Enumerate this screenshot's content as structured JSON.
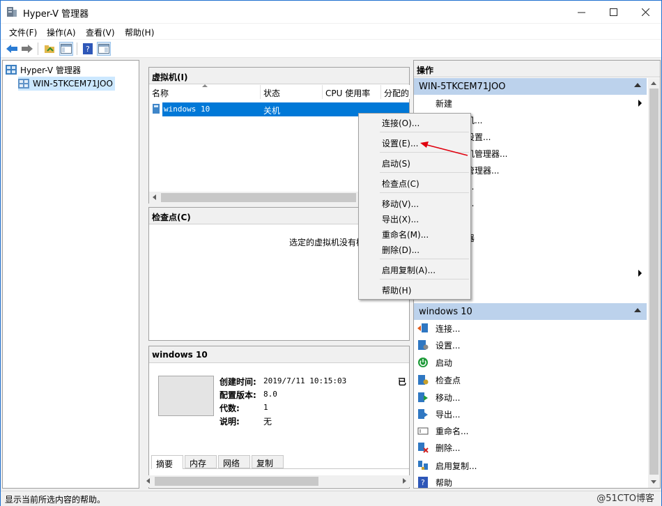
{
  "window": {
    "title": "Hyper-V 管理器"
  },
  "menu": [
    "文件(F)",
    "操作(A)",
    "查看(V)",
    "帮助(H)"
  ],
  "tree": {
    "root": "Hyper-V 管理器",
    "server": "WIN-5TKCEM71JOO"
  },
  "vm_panel": {
    "title": "虚拟机(I)",
    "columns": [
      "名称",
      "状态",
      "CPU 使用率",
      "分配的"
    ],
    "rows": [
      {
        "name": "windows 10",
        "state": "关机"
      }
    ]
  },
  "context_menu": {
    "items": [
      "连接(O)...",
      "设置(E)...",
      "启动(S)",
      "检查点(C)",
      "移动(V)...",
      "导出(X)...",
      "重命名(M)...",
      "删除(D)...",
      "启用复制(A)...",
      "帮助(H)"
    ]
  },
  "checkpoint_panel": {
    "title": "检查点(C)",
    "empty_text": "选定的虚拟机没有检"
  },
  "details_panel": {
    "title": "windows 10",
    "labels": [
      "创建时间:",
      "配置版本:",
      "代数:",
      "说明:"
    ],
    "values": [
      "2019/7/11 10:15:03",
      "8.0",
      "1",
      "无"
    ],
    "clipped_right": "已",
    "tabs": [
      "摘要",
      "内存",
      "网络",
      "复制"
    ]
  },
  "actions": {
    "title": "操作",
    "server_group": "WIN-5TKCEM71JOO",
    "server_items": [
      "新建",
      "机...",
      "设置...",
      "机管理器...",
      "管理器...",
      "...",
      "...",
      "",
      "器",
      "",
      "",
      ""
    ],
    "vm_group": "windows 10",
    "vm_items": [
      "连接...",
      "设置...",
      "启动",
      "检查点",
      "移动...",
      "导出...",
      "重命名...",
      "删除...",
      "启用复制...",
      "帮助"
    ]
  },
  "status": {
    "text": "显示当前所选内容的帮助。"
  },
  "watermark": "@51CTO博客",
  "colors": {
    "selection": "#0078d7",
    "group_header": "#bcd2ec",
    "annotation_arrow": "#e0000e"
  }
}
